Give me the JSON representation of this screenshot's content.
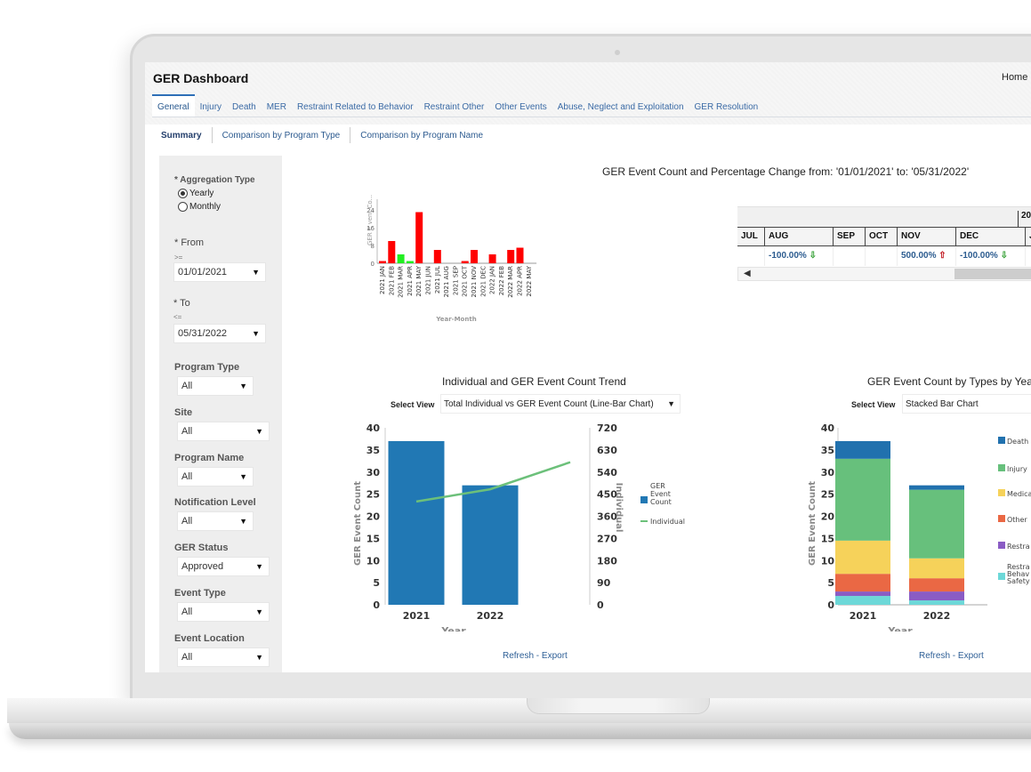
{
  "app": {
    "title": "GER Dashboard",
    "home_link": "Home"
  },
  "tabs": [
    {
      "label": "General",
      "active": true
    },
    {
      "label": "Injury"
    },
    {
      "label": "Death"
    },
    {
      "label": "MER"
    },
    {
      "label": "Restraint Related to Behavior"
    },
    {
      "label": "Restraint Other"
    },
    {
      "label": "Other Events"
    },
    {
      "label": "Abuse, Neglect and Exploitation"
    },
    {
      "label": "GER Resolution"
    }
  ],
  "subtabs": [
    {
      "label": "Summary",
      "active": true
    },
    {
      "label": "Comparison by Program Type"
    },
    {
      "label": "Comparison by Program Name"
    }
  ],
  "filters": {
    "aggregation": {
      "label": "* Aggregation Type",
      "options": [
        {
          "label": "Yearly",
          "selected": true
        },
        {
          "label": "Monthly",
          "selected": false
        }
      ]
    },
    "from": {
      "label": "* From",
      "operator": ">=",
      "value": "01/01/2021"
    },
    "to": {
      "label": "* To",
      "operator": "<=",
      "value": "05/31/2022"
    },
    "program_type": {
      "label": "Program Type",
      "value": "All"
    },
    "site": {
      "label": "Site",
      "value": "All"
    },
    "program_name": {
      "label": "Program Name",
      "value": "All"
    },
    "notification_level": {
      "label": "Notification Level",
      "value": "All"
    },
    "ger_status": {
      "label": "GER Status",
      "value": "Approved"
    },
    "event_type": {
      "label": "Event Type",
      "value": "All"
    },
    "event_location": {
      "label": "Event Location",
      "value": "All"
    }
  },
  "summary_report": {
    "title": "GER Event Count and Percentage Change from: '01/01/2021' to: '05/31/2022'"
  },
  "pct_table": {
    "year_header": "20",
    "columns": [
      "JUL",
      "AUG",
      "SEP",
      "OCT",
      "NOV",
      "DEC",
      "JA"
    ],
    "values": [
      {
        "text": "",
        "dir": ""
      },
      {
        "text": "-100.00%",
        "dir": "down"
      },
      {
        "text": "",
        "dir": ""
      },
      {
        "text": "",
        "dir": ""
      },
      {
        "text": "500.00%",
        "dir": "up"
      },
      {
        "text": "-100.00%",
        "dir": "down"
      },
      {
        "text": "",
        "dir": ""
      }
    ],
    "scroll_left_icon": "◀"
  },
  "trend": {
    "title": "Individual and GER Event Count Trend",
    "select_view_label": "Select View",
    "select_view_value": "Total Individual vs GER Event Count (Line-Bar Chart)",
    "links": {
      "refresh": "Refresh",
      "sep": " - ",
      "export": "Export"
    }
  },
  "types": {
    "title": "GER Event Count by Types by Year",
    "select_view_label": "Select View",
    "select_view_value": "Stacked Bar Chart",
    "links": {
      "refresh": "Refresh",
      "sep": " - ",
      "export": "Export"
    }
  },
  "chart_data": [
    {
      "id": "monthly",
      "type": "bar",
      "title": "",
      "xlabel": "Year-Month",
      "ylabel": "GER E vent Co...",
      "ylim": [
        0,
        28
      ],
      "yticks": [
        0,
        8,
        16,
        24
      ],
      "categories": [
        "2021 JAN",
        "2021 FEB",
        "2021 MAR",
        "2021 APR",
        "2021 MAY",
        "2021 JUN",
        "2021 JUL",
        "2021 AUG",
        "2021 SEP",
        "2021 OCT",
        "2021 NOV",
        "2021 DEC",
        "2022 JAN",
        "2022 FEB",
        "2022 MAR",
        "2022 APR",
        "2022 MAY"
      ],
      "values": [
        1,
        10,
        4,
        1,
        23,
        0,
        6,
        0,
        0,
        1,
        6,
        0,
        4,
        0,
        6,
        7,
        0
      ],
      "bar_colors": [
        "#ff0000",
        "#ff0000",
        "#22ee22",
        "#22ee22",
        "#ff0000",
        "#ff0000",
        "#ff0000",
        "#ff0000",
        "#ff0000",
        "#ff0000",
        "#ff0000",
        "#ff0000",
        "#ff0000",
        "#ff0000",
        "#ff0000",
        "#ff0000",
        "#ff0000"
      ],
      "grid": false
    },
    {
      "id": "trend",
      "type": "bar",
      "title": "Individual and GER Event Count Trend",
      "xlabel": "Year",
      "ylabel": "GER Event Count",
      "y2label": "Individual",
      "categories": [
        "2021",
        "2022"
      ],
      "ylim": [
        0,
        40
      ],
      "yticks": [
        0,
        5,
        10,
        15,
        20,
        25,
        30,
        35,
        40
      ],
      "y2lim": [
        0,
        720
      ],
      "y2ticks": [
        0,
        90,
        180,
        270,
        360,
        450,
        540,
        630,
        720
      ],
      "series": [
        {
          "name": "GER Event Count",
          "kind": "bar",
          "axis": "left",
          "color": "#2178b4",
          "values": [
            37,
            27
          ]
        },
        {
          "name": "Individual",
          "kind": "line",
          "axis": "right",
          "color": "#6cc07a",
          "values": [
            420,
            470,
            580
          ]
        }
      ],
      "legend": [
        "GER Event Count",
        "Individual"
      ],
      "legend_position": "right",
      "grid": false
    },
    {
      "id": "types",
      "type": "bar",
      "stacked": true,
      "title": "GER Event Count by Types by Year",
      "xlabel": "Year",
      "ylabel": "GER Event Count",
      "categories": [
        "2021",
        "2022"
      ],
      "ylim": [
        0,
        40
      ],
      "yticks": [
        0,
        5,
        10,
        15,
        20,
        25,
        30,
        35,
        40
      ],
      "series": [
        {
          "name": "Restraint Related to Behavior - Safety",
          "legend_text": "Restra\nBehav\nSafety",
          "color": "#6dd8d8",
          "values": [
            2,
            1
          ]
        },
        {
          "name": "Restraint",
          "legend_text": "Restra",
          "color": "#8a5cc4",
          "values": [
            1,
            2
          ]
        },
        {
          "name": "Other",
          "legend_text": "Other",
          "color": "#ea6844",
          "values": [
            4,
            3
          ]
        },
        {
          "name": "Medical",
          "legend_text": "Medica",
          "color": "#f6d25a",
          "values": [
            7.5,
            4.5
          ]
        },
        {
          "name": "Injury",
          "legend_text": "Injury",
          "color": "#67c07c",
          "values": [
            18.5,
            15.5
          ]
        },
        {
          "name": "Death",
          "legend_text": "Death",
          "color": "#2171ae",
          "values": [
            4,
            1
          ]
        }
      ],
      "legend_position": "right",
      "grid": false
    }
  ]
}
